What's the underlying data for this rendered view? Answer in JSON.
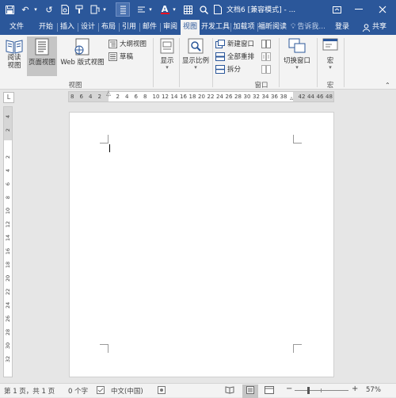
{
  "titlebar": {
    "doc_title": "文档6 [兼容模式] - ...",
    "quick_access": [
      "save-icon",
      "undo-icon",
      "redo-icon",
      "print-preview-icon",
      "format-painter-icon",
      "read-mode-icon",
      "style-icon",
      "font-color-icon",
      "table-icon",
      "search-icon",
      "new-doc-icon",
      "customize-icon"
    ],
    "font_color_label": "A"
  },
  "tabs": [
    "文件",
    "开始",
    "插入",
    "设计",
    "布局",
    "引用",
    "邮件",
    "审阅",
    "视图",
    "开发工具",
    "加载项",
    "福昕阅读"
  ],
  "active_tab": "视图",
  "tell_me": "告诉我...",
  "login": "登录",
  "share": "共享",
  "ribbon": {
    "read_mode": "阅读视图",
    "print_layout": "页面视图",
    "web_layout": "Web 版式视图",
    "outline": "大纲视图",
    "draft": "草稿",
    "views_group": "视图",
    "show": "显示",
    "zoom": "显示比例",
    "new_window": "新建窗口",
    "arrange_all": "全部重排",
    "split": "拆分",
    "window_group": "窗口",
    "switch_windows": "切换窗口",
    "macros": "宏",
    "macros_group": "宏"
  },
  "ruler": {
    "corner": "L",
    "h_numbers": [
      "8",
      "6",
      "4",
      "2",
      "",
      "2",
      "4",
      "6",
      "8",
      "10",
      "12",
      "14",
      "16",
      "18",
      "20",
      "22",
      "24",
      "26",
      "28",
      "30",
      "32",
      "34",
      "36",
      "38",
      "",
      "42",
      "44",
      "46",
      "48"
    ],
    "v_numbers": [
      "4",
      "2",
      "",
      "2",
      "4",
      "6",
      "8",
      "10",
      "12",
      "14",
      "16",
      "18",
      "20",
      "22",
      "24",
      "26",
      "28",
      "30",
      "32"
    ]
  },
  "status": {
    "page": "第 1 页，共 1 页",
    "words": "0 个字",
    "language": "中文(中国)",
    "zoom_percent": "57%",
    "zoom_level": 0.57
  },
  "colors": {
    "title_blue": "#2b579a",
    "ribbon_bg": "#f3f3f3",
    "font_color_red": "#e81123"
  }
}
